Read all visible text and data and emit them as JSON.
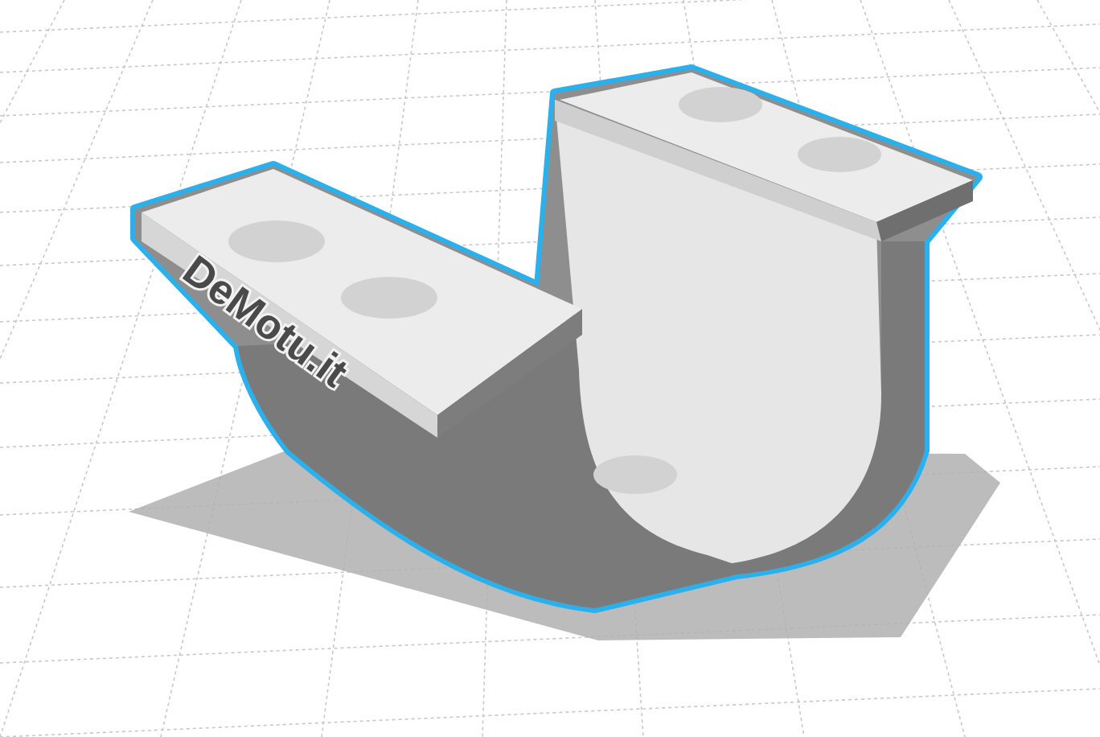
{
  "model": {
    "label": "DeMotu.it",
    "selected": true
  }
}
